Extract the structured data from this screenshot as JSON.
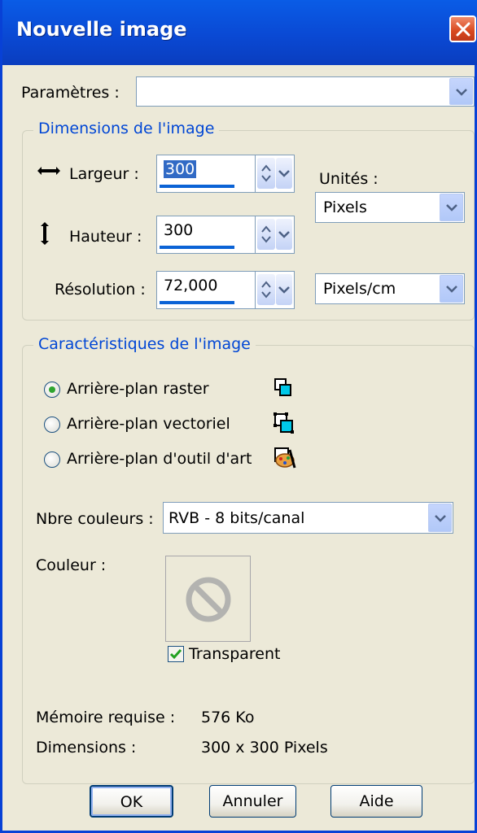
{
  "window": {
    "title": "Nouvelle image"
  },
  "preset": {
    "label": "Paramètres :",
    "value": ""
  },
  "dimensions": {
    "legend": "Dimensions de l'image",
    "width_label": "Largeur :",
    "width_value": "300",
    "height_label": "Hauteur :",
    "height_value": "300",
    "resolution_label": "Résolution :",
    "resolution_value": "72,000",
    "units_label": "Unités :",
    "units_value": "Pixels",
    "resolution_units_value": "Pixels/cm"
  },
  "characteristics": {
    "legend": "Caractéristiques de l'image",
    "background_options": [
      {
        "label": "Arrière-plan raster",
        "selected": true,
        "icon": "raster-layer-icon"
      },
      {
        "label": "Arrière-plan vectoriel",
        "selected": false,
        "icon": "vector-layer-icon"
      },
      {
        "label": "Arrière-plan d'outil d'art",
        "selected": false,
        "icon": "art-media-layer-icon"
      }
    ],
    "colors_label": "Nbre couleurs :",
    "colors_value": "RVB - 8 bits/canal",
    "color_label": "Couleur :",
    "color_swatch_icon": "no-color-icon",
    "transparent_label": "Transparent",
    "transparent_checked": true,
    "memory_label": "Mémoire requise :",
    "memory_value": "576 Ko",
    "dims_label": "Dimensions :",
    "dims_value": "300 x 300 Pixels"
  },
  "buttons": {
    "ok": "OK",
    "cancel": "Annuler",
    "help": "Aide"
  },
  "colors": {
    "titlebar": "#0a49d4",
    "dialog_bg": "#ece9d8",
    "legend_text": "#0046d5",
    "accent": "#0b63d6"
  }
}
